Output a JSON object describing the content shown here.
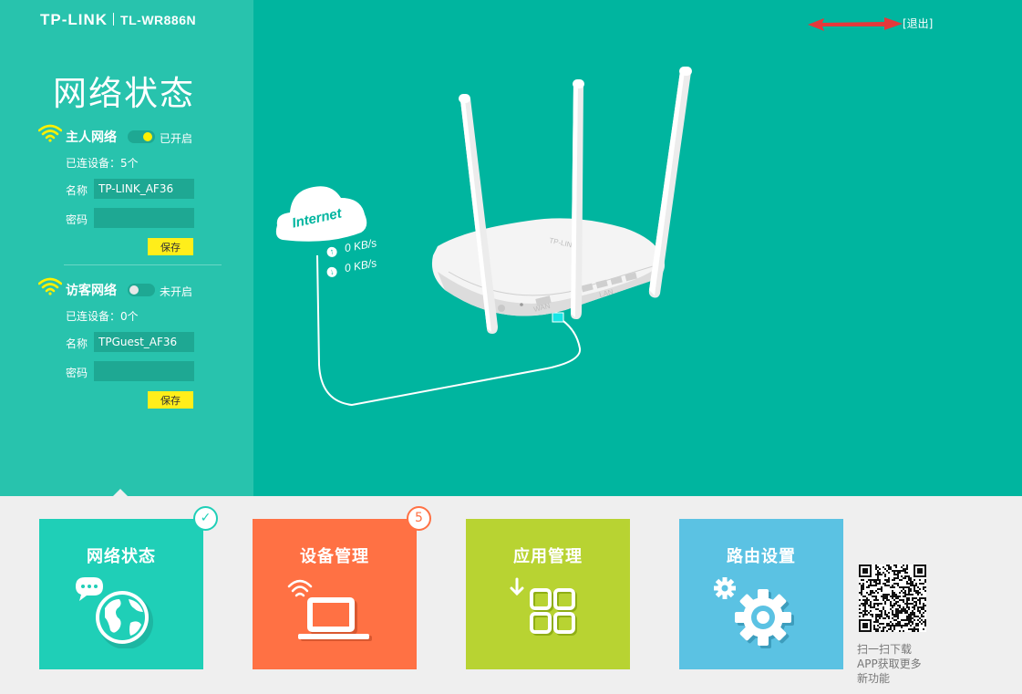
{
  "header": {
    "brand": "TP-LINK",
    "model": "TL-WR886N",
    "logout": "[退出]"
  },
  "page_title": "网络状态",
  "main_network": {
    "title": "主人网络",
    "status": "已开启",
    "enabled": true,
    "devices": "已连设备：5个",
    "name_label": "名称",
    "name_value": "TP-LINK_AF36",
    "password_label": "密码",
    "password_value": "",
    "save": "保存"
  },
  "guest_network": {
    "title": "访客网络",
    "status": "未开启",
    "enabled": false,
    "devices": "已连设备：0个",
    "name_label": "名称",
    "name_value": "TPGuest_AF36",
    "password_label": "密码",
    "password_value": "",
    "save": "保存"
  },
  "diagram": {
    "internet": "Internet",
    "upload": "0 KB/s",
    "download": "0 KB/s",
    "router_brand": "TP-LINK",
    "wan": "WAN",
    "lan": "LAN"
  },
  "tiles": [
    {
      "label": "网络状态",
      "color": "#1fcfb7",
      "icon": "globe-icon",
      "badge": "check"
    },
    {
      "label": "设备管理",
      "color": "#ff7144",
      "icon": "laptop-icon",
      "badge": "5"
    },
    {
      "label": "应用管理",
      "color": "#b8d332",
      "icon": "apps-grid-icon"
    },
    {
      "label": "路由设置",
      "color": "#5bc2e3",
      "icon": "gear-icon"
    }
  ],
  "qr_caption": [
    "扫一扫下载",
    "APP获取更多",
    "新功能"
  ],
  "colors": {
    "main_bg": "#00b59f",
    "sidebar_bg": "#28c3ad",
    "toggle_on": "#fff000",
    "save_button": "#ffee1a",
    "annotation_arrow": "#e5383b"
  }
}
